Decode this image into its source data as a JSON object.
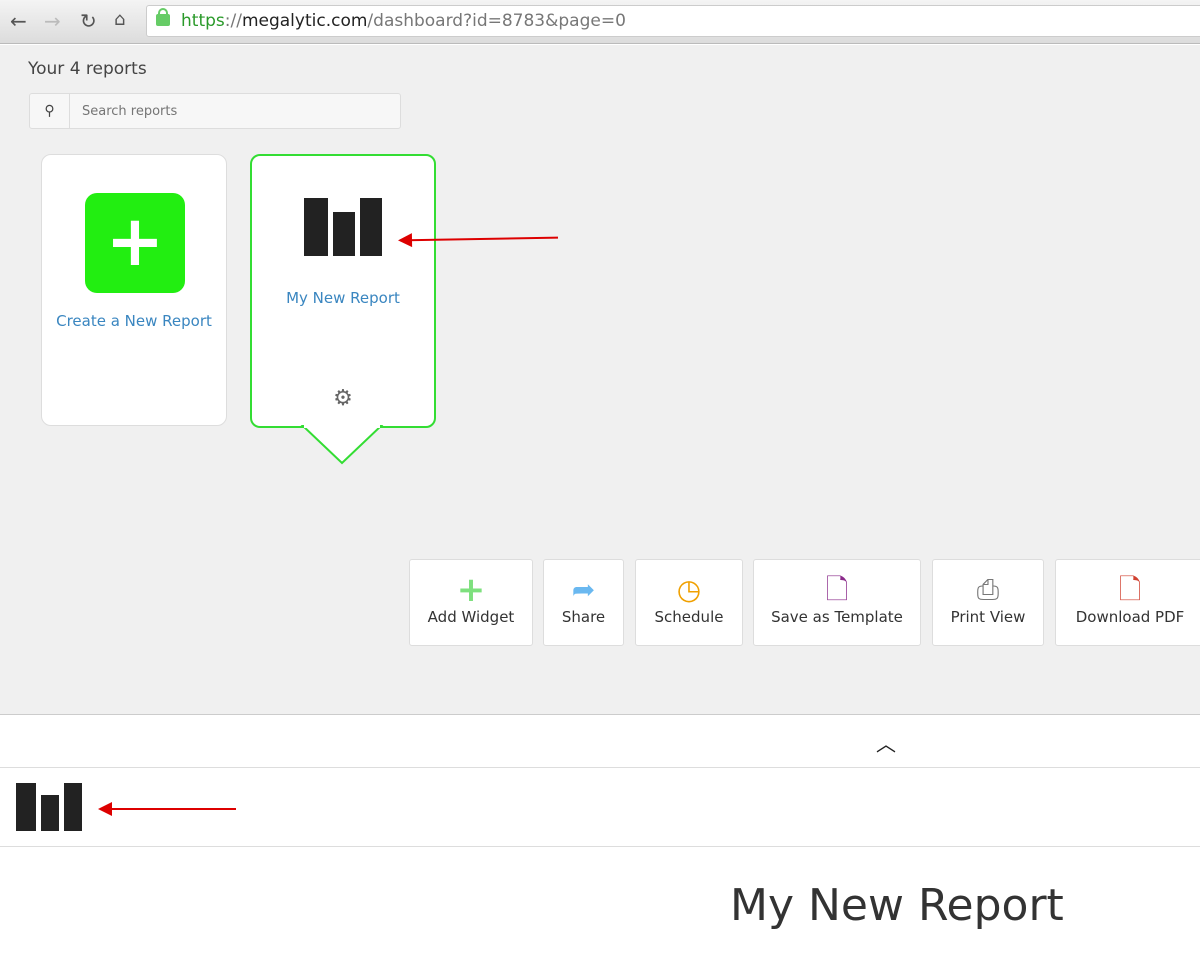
{
  "browser": {
    "url_scheme": "https",
    "url_sep": "://",
    "url_domain": "megalytic.com",
    "url_path": "/dashboard?id=8783&page=0"
  },
  "dashboard": {
    "title": "Your 4 reports",
    "search_placeholder": "Search reports",
    "cards": [
      {
        "label": "Create a New Report"
      },
      {
        "label": "My New Report"
      }
    ]
  },
  "toolbar": [
    {
      "label": "Add Widget",
      "icon": "plus-icon",
      "color": "#7ee07e"
    },
    {
      "label": "Share",
      "icon": "share-icon",
      "color": "#6ab8f0"
    },
    {
      "label": "Schedule",
      "icon": "clock-icon",
      "color": "#f0a000"
    },
    {
      "label": "Save as Template",
      "icon": "file-icon",
      "color": "#8a2a8a"
    },
    {
      "label": "Print View",
      "icon": "printer-icon",
      "color": "#777777"
    },
    {
      "label": "Download PDF",
      "icon": "pdf-icon",
      "color": "#d04030"
    }
  ],
  "report": {
    "title": "My New Report"
  }
}
